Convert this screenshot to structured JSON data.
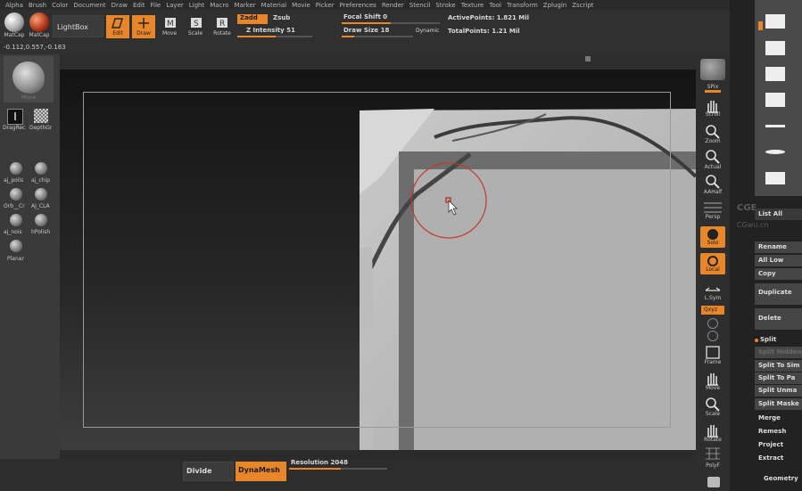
{
  "menu": [
    "Alpha",
    "Brush",
    "Color",
    "Document",
    "Draw",
    "Edit",
    "File",
    "Layer",
    "Light",
    "Macro",
    "Marker",
    "Material",
    "Movie",
    "Picker",
    "Preferences",
    "Render",
    "Stencil",
    "Stroke",
    "Texture",
    "Tool",
    "Transform",
    "Zplugin",
    "Zscript"
  ],
  "shelf": {
    "matcap1": "MatCap",
    "matcap2": "MatCap",
    "lightbox": "LightBox",
    "edit": "Edit",
    "draw": "Draw",
    "move": "Move",
    "scale": "Scale",
    "rotate": "Rotate",
    "zadd": "Zadd",
    "zsub": "Zsub",
    "z_intensity": "Z Intensity 51",
    "focal_shift": "Focal Shift 0",
    "draw_size": "Draw Size 18",
    "dynamic": "Dynamic",
    "active_points": "ActivePoints: 1.821 Mil",
    "total_points": "TotalPoints: 1.21 Mil"
  },
  "coords": "-0.112,0.557,-0.183",
  "left_panel": {
    "brush_label": "Move",
    "drag_rect": "DragRec",
    "depth": "DepthGr",
    "materials": [
      {
        "label": "aj_polis"
      },
      {
        "label": "aj_chip"
      },
      {
        "label": "Orb__Cr"
      },
      {
        "label": "AJ_CLA"
      },
      {
        "label": "aj_nois"
      },
      {
        "label": "hPolish"
      },
      {
        "label": "Planar"
      }
    ]
  },
  "right_shelf": {
    "spix": "SPix",
    "scroll": "Scroll",
    "zoom": "Zoom",
    "actual": "Actual",
    "aahalf": "AAHalf",
    "persp": "Persp",
    "solo": "Solo",
    "local": "Local",
    "lsym": "L.Sym",
    "xyz": "Qxyz",
    "frame": "Frame",
    "move": "Move",
    "scale": "Scale",
    "rotate": "Rotate",
    "polyf": "PolyF"
  },
  "tool_panel": {
    "list_all": "List All",
    "watermark1": "CGE",
    "watermark2": "CGwu.cn",
    "rename": "Rename",
    "all_low": "All Low",
    "copy": "Copy",
    "duplicate": "Duplicate",
    "delete": "Delete",
    "split": "Split",
    "split_hidden": "Split Hidden",
    "split_to_similar": "Split To Sim",
    "split_to_parts": "Split To Pa",
    "split_unmasked": "Split Unma",
    "split_masked": "Split Maske",
    "merge": "Merge",
    "remesh": "Remesh",
    "project": "Project",
    "extract": "Extract",
    "geometry": "Geometry"
  },
  "bottom": {
    "divide": "Divide",
    "dynamesh": "DynaMesh",
    "resolution": "Resolution 2048"
  },
  "colors": {
    "accent": "#e8862a"
  }
}
